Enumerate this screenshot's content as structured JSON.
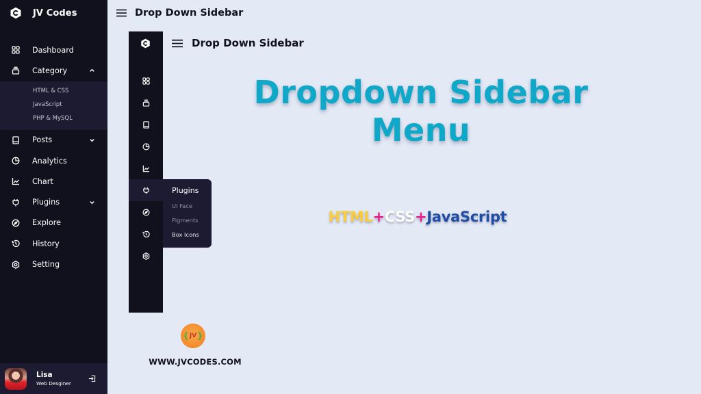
{
  "sidebar": {
    "brand": "JV Codes",
    "items": [
      {
        "label": "Dashboard",
        "icon": "grid-icon"
      },
      {
        "label": "Category",
        "icon": "collection-icon",
        "expanded": true,
        "children": [
          "HTML & CSS",
          "JavaScript",
          "PHP & MySQL"
        ]
      },
      {
        "label": "Posts",
        "icon": "book-icon",
        "expanded": false
      },
      {
        "label": "Analytics",
        "icon": "pie-chart-icon"
      },
      {
        "label": "Chart",
        "icon": "line-chart-icon"
      },
      {
        "label": "Plugins",
        "icon": "plug-icon",
        "expanded": false
      },
      {
        "label": "Explore",
        "icon": "compass-icon"
      },
      {
        "label": "History",
        "icon": "history-icon"
      },
      {
        "label": "Setting",
        "icon": "cog-icon"
      }
    ],
    "profile": {
      "name": "Lisa",
      "job": "Web Desginer"
    }
  },
  "header": {
    "title": "Drop Down Sidebar"
  },
  "preview": {
    "title": "Drop Down Sidebar",
    "flyout": {
      "title": "Plugins",
      "items": [
        "UI Face",
        "Pigments",
        "Box Icons"
      ]
    }
  },
  "hero": {
    "line1": "Dropdown Sidebar",
    "line2": "Menu",
    "tech": {
      "html": "HTML",
      "plus": "+",
      "css": "CSS",
      "js": "JavaScript"
    }
  },
  "brand_footer": {
    "badge": "JV",
    "site": "WWW.JVCODES.COM"
  },
  "colors": {
    "sidebar_bg": "#11101d",
    "submenu_bg": "#1d1b31",
    "page_bg": "#e4e9f6",
    "hero": "#10a8c9"
  }
}
